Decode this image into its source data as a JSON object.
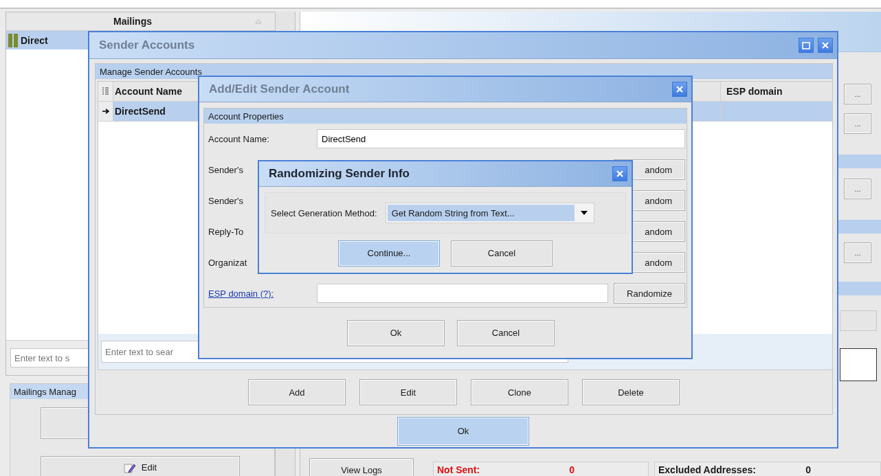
{
  "main": {
    "mailings_header": "Mailings",
    "mailings": [
      {
        "label": "Direct",
        "selected": true
      }
    ],
    "search_placeholder": "Enter text to s",
    "group_title": "Mailings Manag",
    "edit_button": "Edit",
    "side_buttons": [
      "...",
      "...",
      "...",
      "..."
    ],
    "view_logs_button": "View Logs",
    "stats": [
      {
        "label": "Not Sent:",
        "value": "0",
        "kind": "error"
      },
      {
        "label": "Excluded Addresses:",
        "value": "0",
        "kind": "normal"
      }
    ]
  },
  "sender_accounts": {
    "title": "Sender Accounts",
    "group_title": "Manage Sender Accounts",
    "columns": [
      "Account Name",
      "ESP domain"
    ],
    "rows": [
      {
        "account_name": "DirectSend",
        "selected": true
      }
    ],
    "search_placeholder": "Enter text to sear",
    "buttons": [
      "Add",
      "Edit",
      "Clone",
      "Delete"
    ],
    "ok_button": {
      "label": "Ok",
      "default": true
    }
  },
  "add_edit": {
    "title": "Add/Edit Sender Account",
    "group_title": "Account Properties",
    "account_name_label": "Account Name:",
    "account_name_value": "DirectSend",
    "fields": [
      {
        "label": "Sender's",
        "button": "andom",
        "kind": "covered"
      },
      {
        "label": "Sender's",
        "button": "andom",
        "kind": "covered"
      },
      {
        "label": "Reply-To",
        "button": "andom",
        "kind": "covered"
      },
      {
        "label": "Organizat",
        "button": "andom",
        "kind": "plain"
      },
      {
        "label": "ESP domain (?):",
        "button": "Randomize",
        "kind": "link"
      }
    ],
    "buttons": [
      "Ok",
      "Cancel"
    ]
  },
  "randomize": {
    "title": "Randomizing Sender Info",
    "method_label": "Select Generation Method:",
    "method_value": "Get Random String from Text...",
    "buttons": [
      {
        "label": "Continue...",
        "default": true
      },
      {
        "label": "Cancel",
        "default": false
      }
    ]
  }
}
